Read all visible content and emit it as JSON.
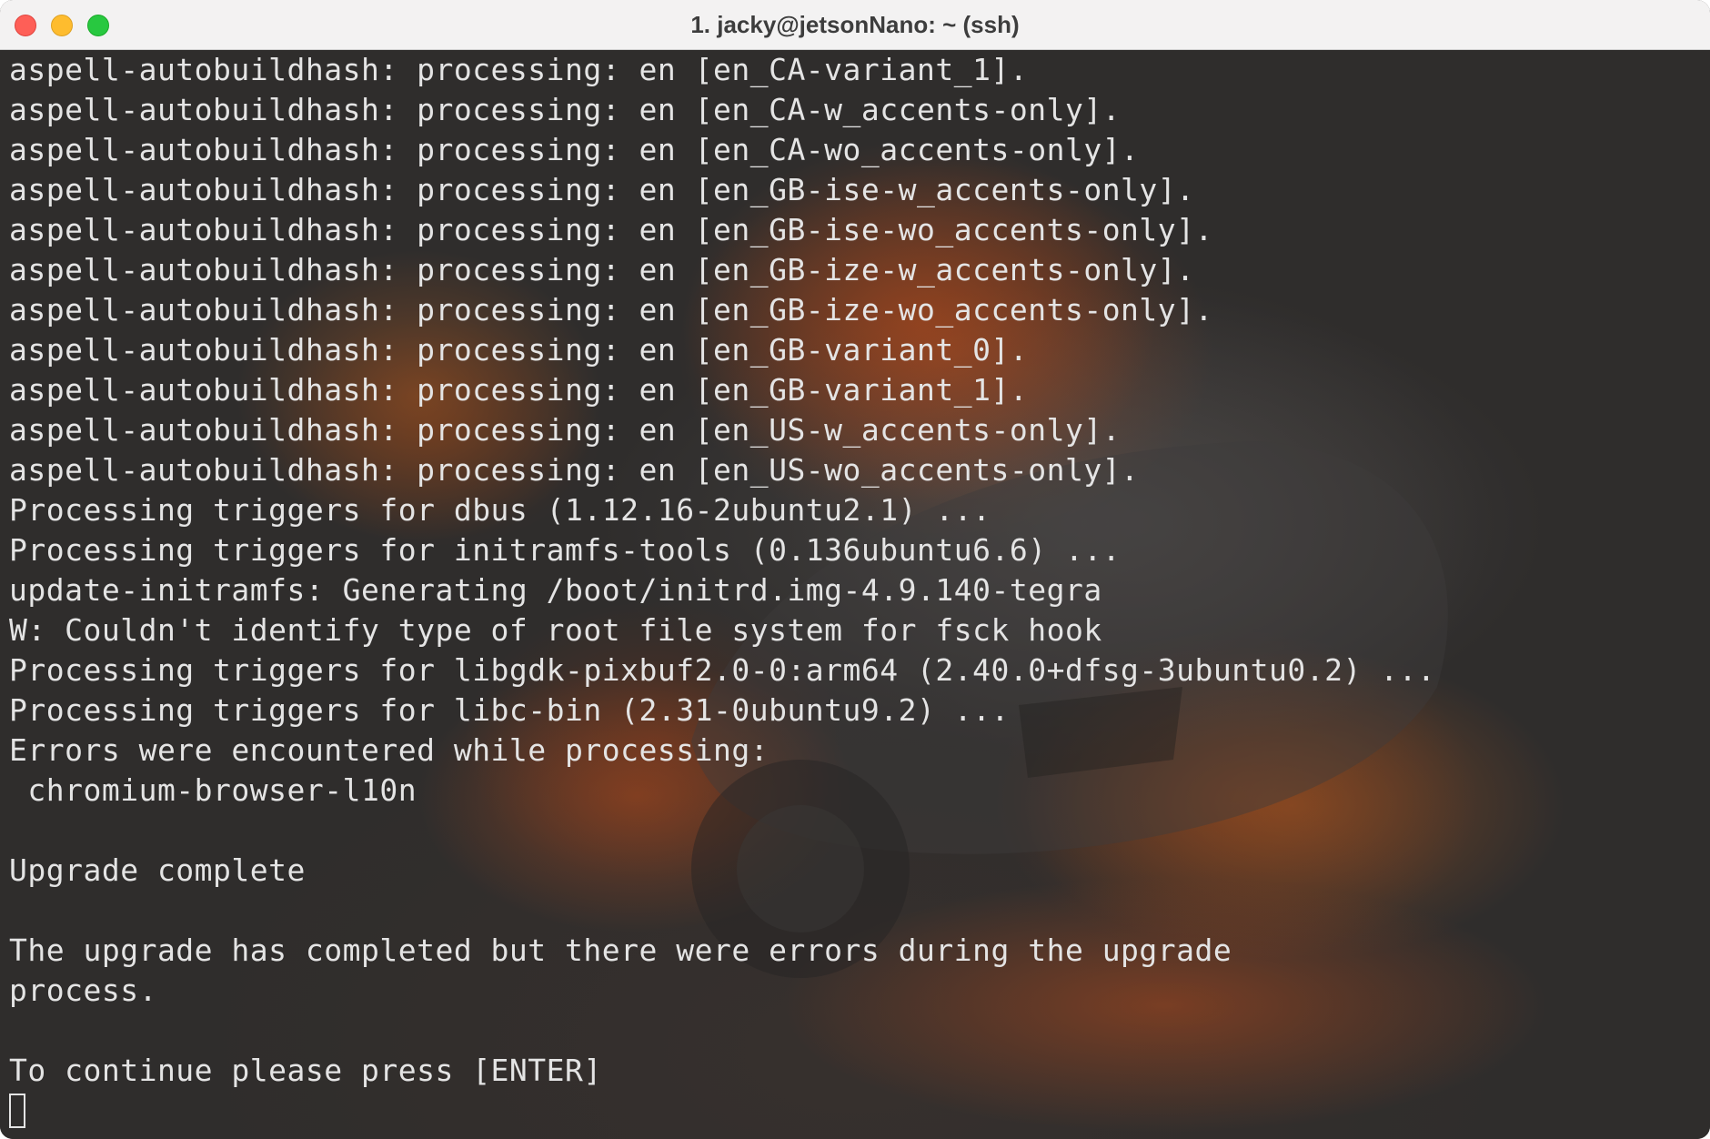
{
  "window": {
    "title": "1. jacky@jetsonNano: ~ (ssh)"
  },
  "colors": {
    "titlebar_bg": "#f3f2f2",
    "terminal_bg": "#2f2d2c",
    "terminal_text": "#e4e4e4",
    "close": "#fe5f57",
    "minimize": "#febc2e",
    "zoom": "#28c840"
  },
  "icons": {
    "close": "close-traffic-light-icon",
    "minimize": "minimize-traffic-light-icon",
    "zoom": "zoom-traffic-light-icon",
    "cursor": "block-cursor-icon"
  },
  "terminal": {
    "lines": [
      "aspell-autobuildhash: processing: en [en_CA-variant_1].",
      "aspell-autobuildhash: processing: en [en_CA-w_accents-only].",
      "aspell-autobuildhash: processing: en [en_CA-wo_accents-only].",
      "aspell-autobuildhash: processing: en [en_GB-ise-w_accents-only].",
      "aspell-autobuildhash: processing: en [en_GB-ise-wo_accents-only].",
      "aspell-autobuildhash: processing: en [en_GB-ize-w_accents-only].",
      "aspell-autobuildhash: processing: en [en_GB-ize-wo_accents-only].",
      "aspell-autobuildhash: processing: en [en_GB-variant_0].",
      "aspell-autobuildhash: processing: en [en_GB-variant_1].",
      "aspell-autobuildhash: processing: en [en_US-w_accents-only].",
      "aspell-autobuildhash: processing: en [en_US-wo_accents-only].",
      "Processing triggers for dbus (1.12.16-2ubuntu2.1) ...",
      "Processing triggers for initramfs-tools (0.136ubuntu6.6) ...",
      "update-initramfs: Generating /boot/initrd.img-4.9.140-tegra",
      "W: Couldn't identify type of root file system for fsck hook",
      "Processing triggers for libgdk-pixbuf2.0-0:arm64 (2.40.0+dfsg-3ubuntu0.2) ...",
      "Processing triggers for libc-bin (2.31-0ubuntu9.2) ...",
      "Errors were encountered while processing:",
      " chromium-browser-l10n",
      "",
      "Upgrade complete",
      "",
      "The upgrade has completed but there were errors during the upgrade",
      "process.",
      "",
      "To continue please press [ENTER]"
    ]
  }
}
